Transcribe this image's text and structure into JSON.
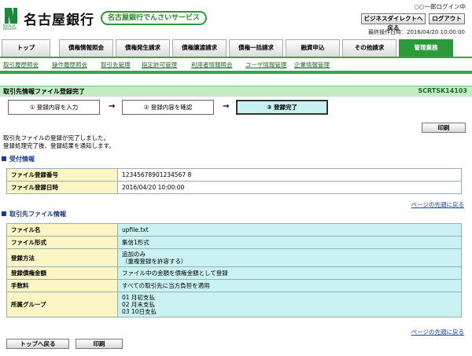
{
  "header": {
    "bank_name": "名古屋銀行",
    "logo_sub": "Bank of NAGOYA",
    "service_name": "名古屋銀行でんさいサービス",
    "user_login": "○○一郎ログイン中",
    "business_direct_button": "ビジネスダイレクトへ戻る",
    "logout_button": "ログアウト",
    "last_operation": "最終操作日時：2016/04/20 10:00:00"
  },
  "tabs": [
    "トップ",
    "債権情報照会",
    "債権発生請求",
    "債権譲渡請求",
    "債権一括請求",
    "融資申込",
    "その他請求",
    "管理業務"
  ],
  "subnav": [
    "取引履歴照会",
    "操作履歴照会",
    "取引先管理",
    "指定許可管理",
    "利用者情報照会",
    "ユーザ情報管理",
    "企業情報管理"
  ],
  "page": {
    "title": "取引先情報ファイル登録完了",
    "screen_code": "SCRTSK14103"
  },
  "steps": [
    "① 登録内容を入力",
    "② 登録内容を確認",
    "③ 登録完了"
  ],
  "arrow": "→",
  "print_label": "印刷",
  "message": {
    "line1": "取引先ファイルの登録が完了しました。",
    "line2": "登録処理完了後、登録結果を通知します。"
  },
  "reception": {
    "heading": "受付情報",
    "rows": [
      {
        "label": "ファイル登録番号",
        "value": "12345678901234567 8"
      },
      {
        "label": "ファイル登録日時",
        "value": "2016/04/20 10:00:00"
      }
    ]
  },
  "file_info": {
    "heading": "取引先ファイル情報",
    "file_name_label": "ファイル名",
    "file_name": "upfile.txt",
    "format_label": "ファイル形式",
    "format": "集信1形式",
    "method_label": "登録方法",
    "method_1": "追加のみ",
    "method_2": "（重複登録を許容する）",
    "amount_label": "登録債権金額",
    "amount": "ファイル中の金額を債権金額として登録",
    "fee_label": "手数料",
    "fee": "すべての取引先に当方負担を適用",
    "group_label": "所属グループ",
    "group_1": "01 月初支払",
    "group_2": "02 月末支払",
    "group_3": "03 10日支払"
  },
  "page_top_link": "ページの先頭に戻る",
  "back_to_top_button": "トップへ戻る"
}
